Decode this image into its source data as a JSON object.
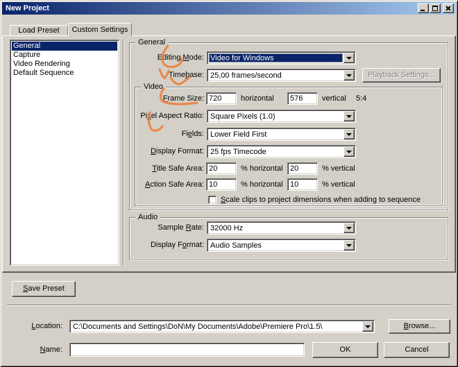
{
  "window": {
    "title": "New Project",
    "controls": [
      "minimize",
      "maximize",
      "close"
    ]
  },
  "tabs": {
    "load_preset": "Load Preset",
    "custom_settings": "Custom Settings"
  },
  "preset_list": {
    "items": [
      "General",
      "Capture",
      "Video Rendering",
      "Default Sequence"
    ],
    "selected": "General"
  },
  "groups": {
    "general": "General",
    "video": "Video",
    "audio": "Audio"
  },
  "general": {
    "editing_mode_label": {
      "pre": "Editing ",
      "key": "M",
      "post": "ode:"
    },
    "editing_mode_value": "Video for Windows",
    "timebase_label": {
      "pre": "Time",
      "key": "b",
      "post": "ase:"
    },
    "timebase_value": "25,00 frames/second",
    "playback_settings_label": {
      "pre": "Pla",
      "key": "y",
      "post": "back Settings..."
    }
  },
  "video": {
    "frame_size_label": {
      "pre": "",
      "key": "F",
      "post": "rame Size:"
    },
    "frame_width": "720",
    "frame_width_unit": "horizontal",
    "frame_height": "576",
    "frame_height_unit": "vertical",
    "aspect_ratio": "5:4",
    "pixel_aspect_label": {
      "pre": "Pi",
      "key": "x",
      "post": "el Aspect Ratio:"
    },
    "pixel_aspect_value": "Square Pixels (1.0)",
    "fields_label": {
      "pre": "Fi",
      "key": "e",
      "post": "lds:"
    },
    "fields_value": "Lower Field First",
    "display_format_label": {
      "pre": "",
      "key": "D",
      "post": "isplay Format:"
    },
    "display_format_value": "25 fps Timecode",
    "title_safe_label": {
      "pre": "",
      "key": "T",
      "post": "itle Safe Area:"
    },
    "title_safe_h": "20",
    "title_safe_h_unit": "% horizontal",
    "title_safe_v": "20",
    "title_safe_v_unit": "% vertical",
    "action_safe_label": {
      "pre": "",
      "key": "A",
      "post": "ction Safe Area:"
    },
    "action_safe_h": "10",
    "action_safe_h_unit": "% horizontal",
    "action_safe_v": "10",
    "action_safe_v_unit": "% vertical",
    "scale_clips_label": {
      "pre": "",
      "key": "S",
      "post": "cale clips to project dimensions when adding to sequence"
    },
    "scale_clips_checked": false
  },
  "audio": {
    "sample_rate_label": {
      "pre": "Sample ",
      "key": "R",
      "post": "ate:"
    },
    "sample_rate_value": "32000 Hz",
    "display_format_label": {
      "pre": "Display F",
      "key": "o",
      "post": "rmat:"
    },
    "display_format_value": "Audio Samples"
  },
  "buttons": {
    "save_preset": {
      "pre": "",
      "key": "S",
      "post": "ave Preset"
    },
    "browse": {
      "pre": "",
      "key": "B",
      "post": "rowse..."
    },
    "ok": "OK",
    "cancel": "Cancel"
  },
  "footer": {
    "location_label": {
      "pre": "",
      "key": "L",
      "post": "ocation:"
    },
    "location_value": "C:\\Documents and Settings\\DoN\\My Documents\\Adobe\\Premiere Pro\\1.5\\",
    "name_label": {
      "pre": "",
      "key": "N",
      "post": "ame:"
    },
    "name_value": ""
  },
  "colors": {
    "selection": "#0a246a",
    "titlebar_start": "#0a246a",
    "titlebar_end": "#a6caf0",
    "annotation": "#ec7f3a"
  },
  "annotations": {
    "color": "#ec7f3a",
    "strokes": [
      "M242,66 C236,74 231,82 235,90 C238,97 249,99 258,93 C261,91 263,87 261,84",
      "M230,100 C232,106 234,110 237,113 C240,109 242,105 243,102",
      "M246,112 C250,119 255,122 259,121 C264,119 269,115 273,111",
      "M236,128 C231,134 230,141 234,146 C245,151 264,151 284,148",
      "M216,162 C213,170 214,179 218,186 C222,190 229,189 234,182"
    ]
  }
}
